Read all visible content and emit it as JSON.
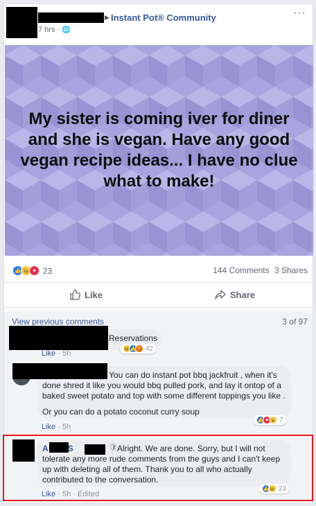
{
  "post": {
    "group_name": "Instant Pot® Community",
    "time": "7 hrs",
    "more_label": "···",
    "banner_text": "My sister is coming iver for diner and she is vegan. Have any good vegan recipe ideas... I have no clue what to make!",
    "banner_color": "#a19dd9",
    "reaction_count": "23",
    "comments_count": "144 Comments",
    "shares_count": "3 Shares",
    "like_label": "Like",
    "share_label": "Share"
  },
  "comments_section": {
    "view_previous": "View previous comments",
    "pagination": "3 of 97",
    "comments": [
      {
        "text": "Reservations",
        "like_label": "Like",
        "time": "5h",
        "reaction_count": "42"
      },
      {
        "text_1": "You can do instant pot bbq jackfruit , when it's done shred it like you would bbq pulled pork, and lay it ontop of a baked sweet potato and top with some different toppings you like .",
        "text_2": "Or you can do a potato coconut curry soup",
        "like_label": "Like",
        "time": "5h",
        "reaction_count": "7"
      },
      {
        "author_initial": "A",
        "author_part": "S",
        "text": "Alright. We are done. Sorry, but I will not tolerate any more rude comments from the guys and I can't keep up with deleting all of them. Thank you to all who actually contributed to the conversation.",
        "like_label": "Like",
        "time": "5h",
        "edited": "Edited",
        "reaction_count": "23"
      }
    ]
  },
  "colors": {
    "facebook_blue": "#385898",
    "highlight_red": "#e01b24"
  }
}
